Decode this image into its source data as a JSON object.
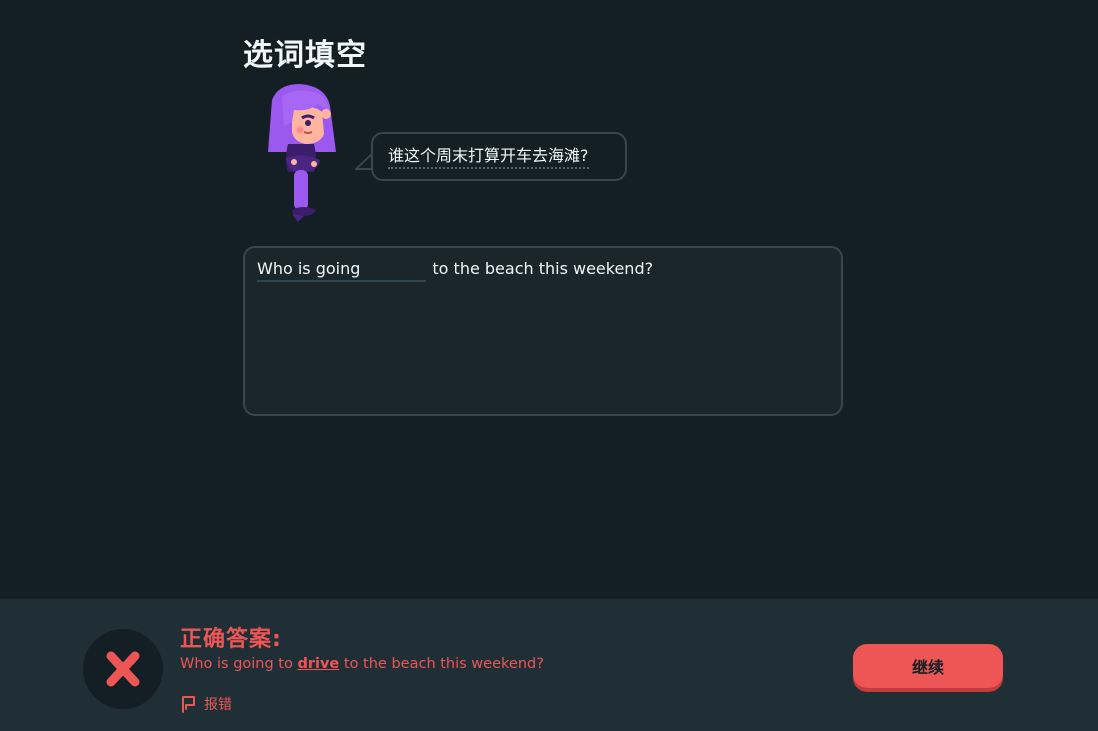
{
  "exercise": {
    "title": "选词填空"
  },
  "prompt": {
    "bubble_text": "谁这个周末打算开车去海滩?"
  },
  "answer": {
    "before_blank": "Who is going",
    "after_blank": "to the beach this weekend?"
  },
  "feedback": {
    "title": "正确答案:",
    "sentence_before": "Who is going to ",
    "answer_word": "drive",
    "sentence_after": " to the beach this weekend?",
    "report_label": "报错",
    "continue_label": "继续",
    "status": "incorrect",
    "status_icon": "x-mark-icon",
    "report_icon": "flag-icon"
  },
  "colors": {
    "background": "#131f24",
    "footer_background": "#202f36",
    "error": "#ee5555",
    "character_purple": "#9b5de5"
  }
}
